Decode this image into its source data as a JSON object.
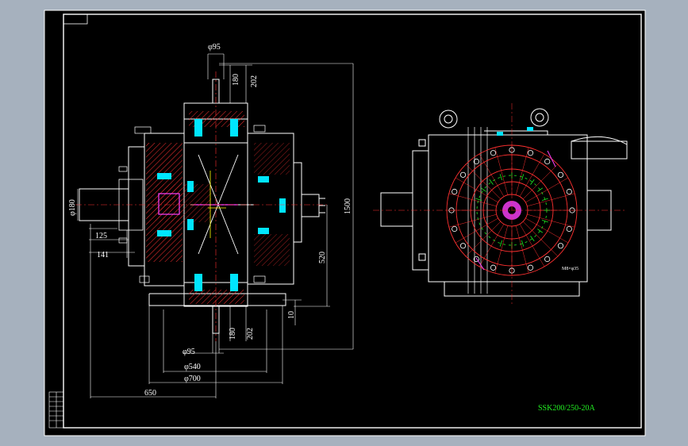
{
  "colors": {
    "background": "#a6b1be",
    "paper": "#000000",
    "outline": "#ffffff",
    "hatch": "#ff3030",
    "cyan": "#00e5ff",
    "green": "#22ee22",
    "magenta": "#ff40ff",
    "yellow": "#ffff00"
  },
  "drawing": {
    "code": "SSK200/250-20A"
  },
  "dimensions": {
    "shaft_dia_top": "φ95",
    "len_180_top": "180",
    "len_202_top": "202",
    "overall_1500": "1500",
    "shaft_dia_left": "φ180",
    "len_125": "125",
    "len_141": "141",
    "len_520": "520",
    "len_10": "10",
    "len_180_bottom": "180",
    "len_202_bottom": "202",
    "shaft_dia_bottom": "φ95",
    "dia_540": "φ540",
    "dia_700": "φ700",
    "width_650": "650"
  },
  "side_view": {
    "bolt_label": "M8×φ35"
  },
  "icons": [
    "lifting-eye-icon",
    "bolt-hole-icon"
  ]
}
